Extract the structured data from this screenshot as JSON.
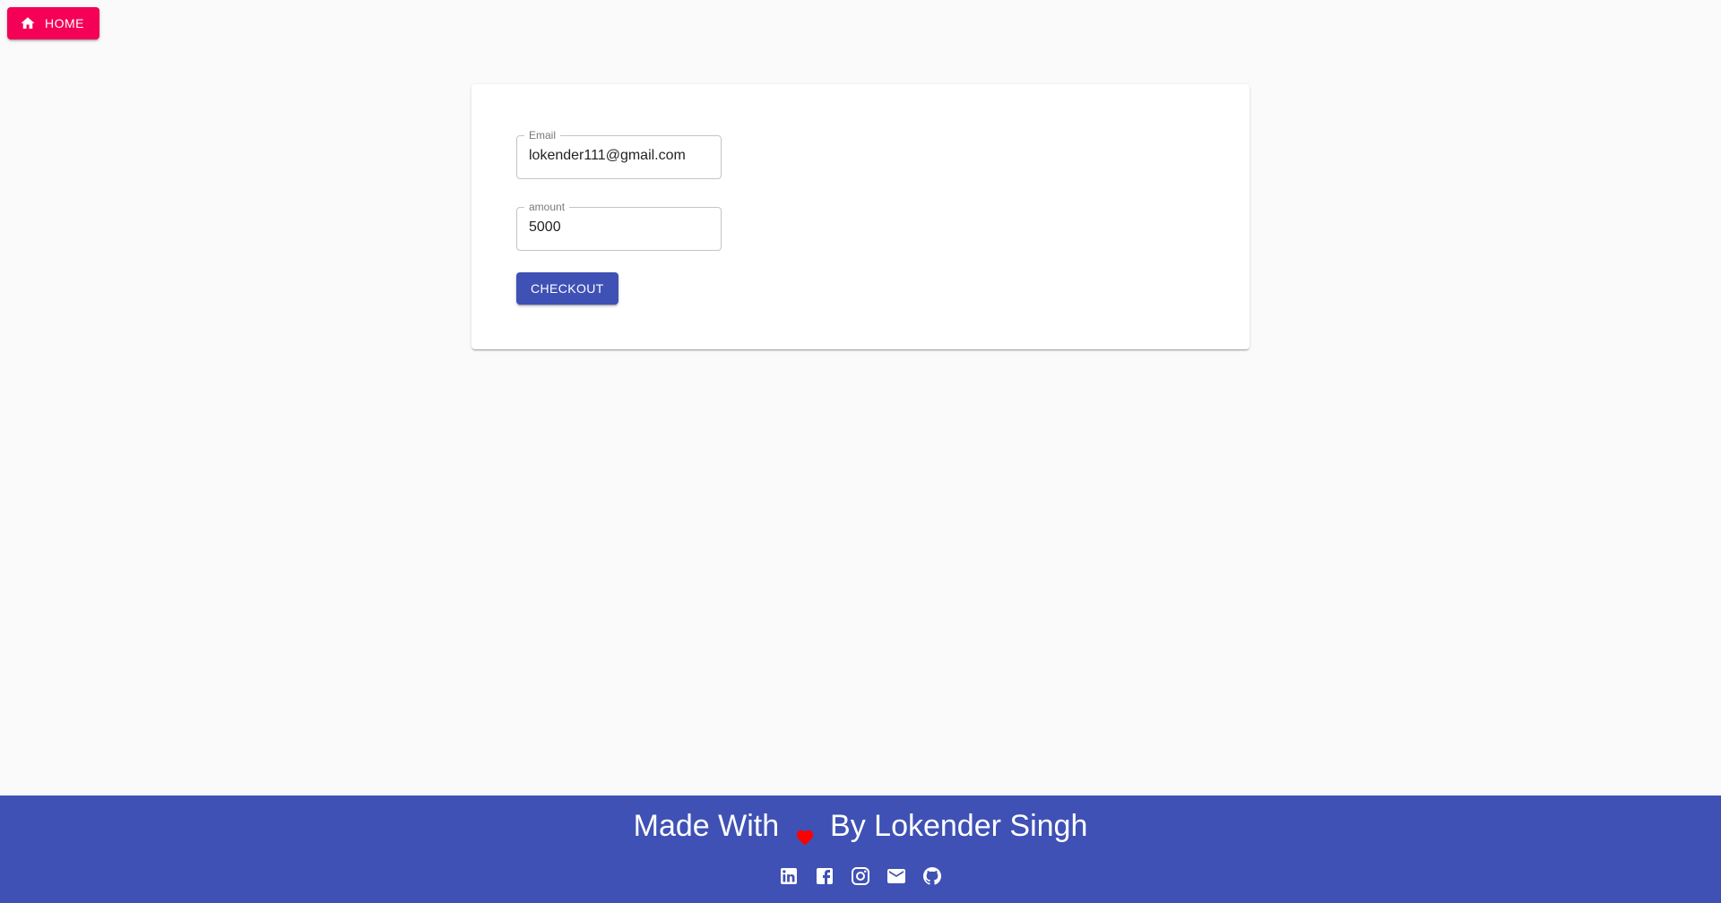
{
  "header": {
    "home_label": "HOME",
    "home_icon": "home-icon"
  },
  "form": {
    "email_label": "Email",
    "email_value": "lokender111@gmail.com",
    "amount_label": "amount",
    "amount_value": "5000",
    "checkout_label": "CHECKOUT"
  },
  "footer": {
    "text_before": "Made With",
    "text_after": "By Lokender Singh",
    "heart_icon": "heart-icon",
    "social_icons": [
      "linkedin-icon",
      "facebook-icon",
      "instagram-icon",
      "mail-icon",
      "github-icon"
    ]
  },
  "colors": {
    "accent": "#f50057",
    "primary": "#3f51b5",
    "heart": "#ff0000",
    "background": "#fafafa"
  }
}
